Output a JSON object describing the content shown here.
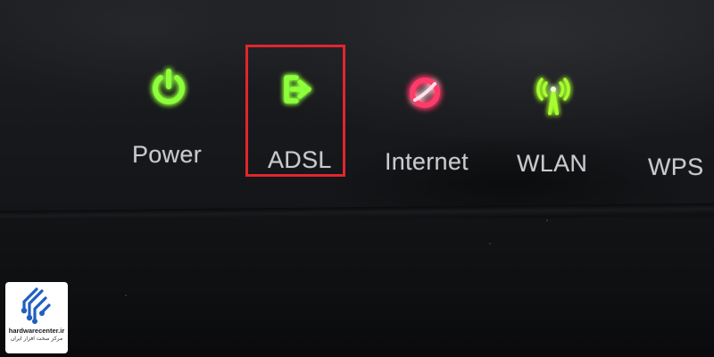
{
  "indicators": [
    {
      "label": "Power",
      "icon": "power-icon",
      "led_color": "#7dff2a",
      "state": "on"
    },
    {
      "label": "ADSL",
      "icon": "adsl-icon",
      "led_color": "#7dff2a",
      "state": "on",
      "highlighted": true
    },
    {
      "label": "Internet",
      "icon": "internet-icon",
      "led_color": "#ff3b6b",
      "state": "on"
    },
    {
      "label": "WLAN",
      "icon": "wlan-icon",
      "led_color": "#9dff2a",
      "state": "on"
    },
    {
      "label": "WPS",
      "icon": "wps-icon",
      "state": "off"
    }
  ],
  "highlight": {
    "color": "#e0262e",
    "target": "ADSL"
  },
  "watermark": {
    "site": "hardwarecenter.ir",
    "tagline": "مرکز سخت افزار ایران",
    "logo": "circuit-logo-icon",
    "accent": "#1f5fbf"
  }
}
